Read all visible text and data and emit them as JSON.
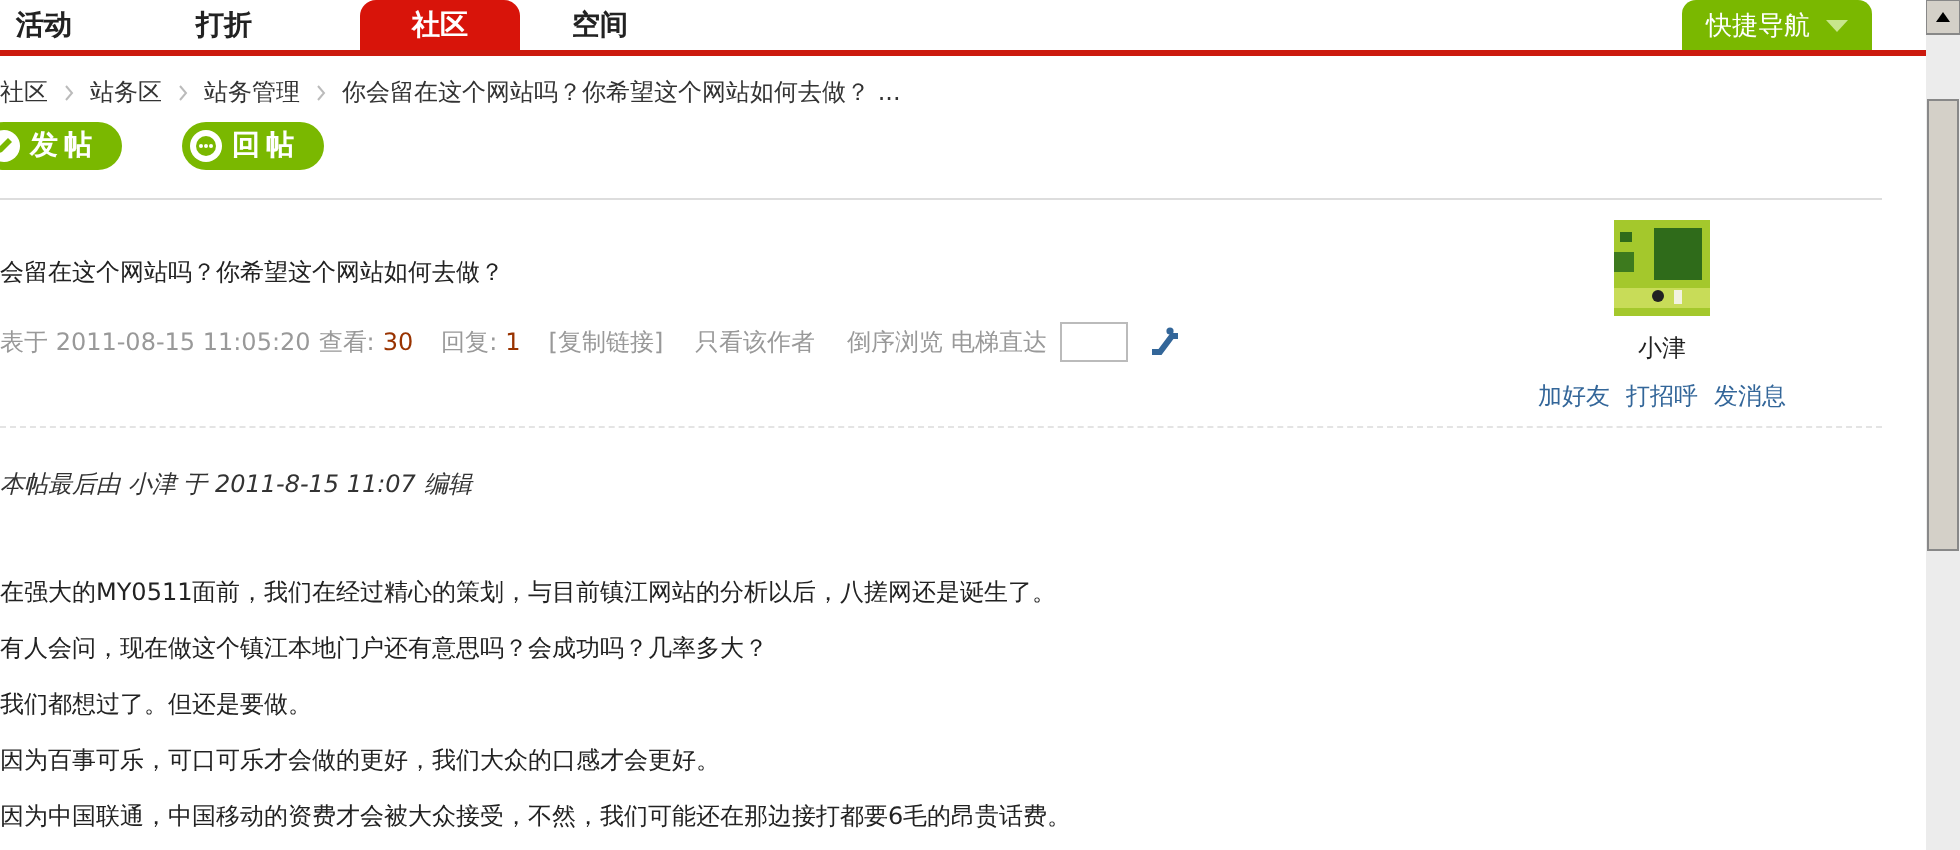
{
  "nav": {
    "tabs": [
      {
        "label": "活动",
        "selected": false
      },
      {
        "label": "打折",
        "selected": false
      },
      {
        "label": "社区",
        "selected": true
      },
      {
        "label": "空间",
        "selected": false
      }
    ],
    "quick_nav": "快捷导航"
  },
  "breadcrumb": [
    "社区",
    "站务区",
    "站务管理",
    "你会留在这个网站吗？你希望这个网站如何去做？ ..."
  ],
  "actions": [
    {
      "label": "发帖",
      "kind": "post"
    },
    {
      "label": "回帖",
      "kind": "reply"
    }
  ],
  "post": {
    "title": "会留在这个网站吗？你希望这个网站如何去做？",
    "meta": {
      "posted": "表于 2011-08-15 11:05:20",
      "views_label": "查看:",
      "views": "30",
      "replies_label": "回复:",
      "replies": "1",
      "links": [
        "[复制链接]",
        "只看该作者",
        "倒序浏览"
      ],
      "jump_label": "电梯直达"
    },
    "author": {
      "name": "小津",
      "actions": [
        "加好友",
        "打招呼",
        "发消息"
      ]
    },
    "edit_note": "本帖最后由 小津 于 2011-8-15 11:07 编辑",
    "body": [
      "在强大的MY0511面前，我们在经过精心的策划，与目前镇江网站的分析以后，八搓网还是诞生了。",
      "有人会问，现在做这个镇江本地门户还有意思吗？会成功吗？几率多大？",
      "我们都想过了。但还是要做。",
      "因为百事可乐，可口可乐才会做的更好，我们大众的口感才会更好。",
      "因为中国联通，中国移动的资费才会被大众接受，不然，我们可能还在那边接打都要6毛的昂贵话费。"
    ]
  }
}
